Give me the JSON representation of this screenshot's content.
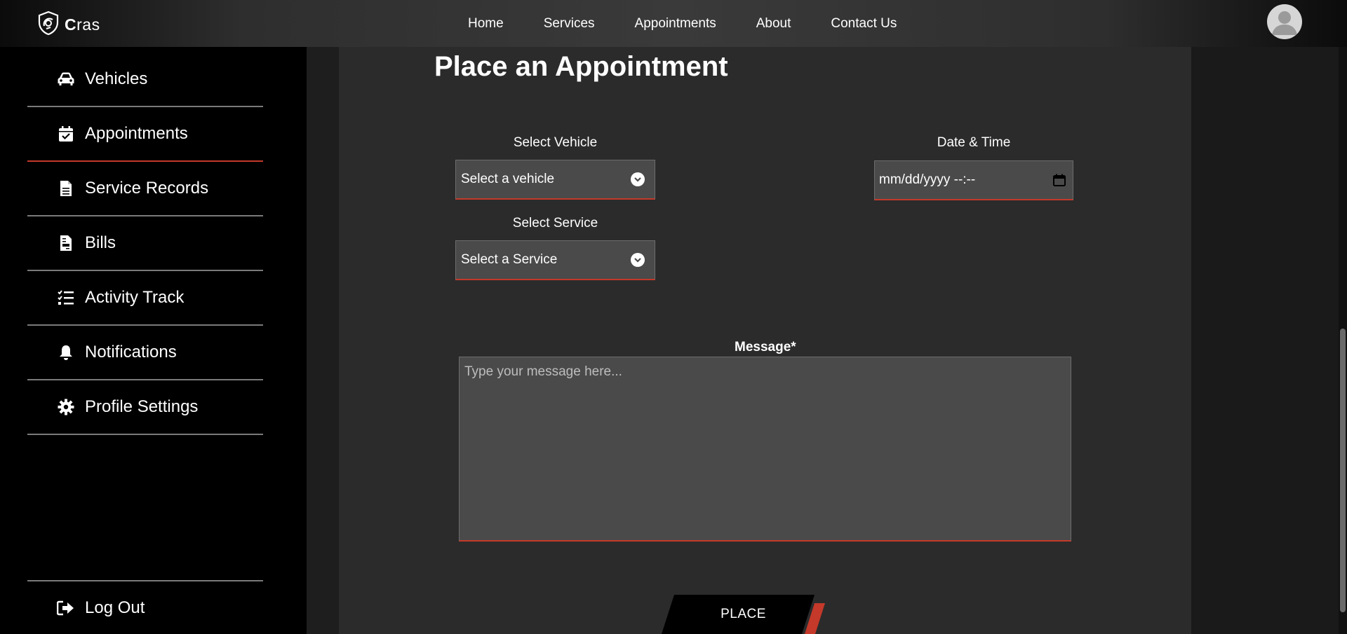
{
  "brand": {
    "name": "Cras"
  },
  "nav": {
    "links": [
      "Home",
      "Services",
      "Appointments",
      "About",
      "Contact Us"
    ]
  },
  "sidebar": {
    "items": [
      {
        "label": "Vehicles",
        "icon": "car-icon"
      },
      {
        "label": "Appointments",
        "icon": "calendar-check-icon",
        "active": true
      },
      {
        "label": "Service Records",
        "icon": "document-icon"
      },
      {
        "label": "Bills",
        "icon": "invoice-icon"
      },
      {
        "label": "Activity Track",
        "icon": "tasks-list-icon"
      },
      {
        "label": "Notifications",
        "icon": "bell-icon"
      },
      {
        "label": "Profile Settings",
        "icon": "gear-icon"
      }
    ],
    "logout": {
      "label": "Log Out",
      "icon": "logout-icon"
    }
  },
  "main": {
    "title": "Place an Appointment",
    "vehicle": {
      "label": "Select Vehicle",
      "value": "Select a vehicle"
    },
    "service": {
      "label": "Select Service",
      "value": "Select a Service"
    },
    "datetime": {
      "label": "Date & Time",
      "value": "mm/dd/yyyy --:--"
    },
    "message": {
      "label": "Message*",
      "placeholder": "Type your message here..."
    },
    "submit_label": "PLACE"
  },
  "colors": {
    "accent": "#c4392a",
    "panel": "#2b2b2b",
    "field": "#4a4a4a",
    "sidebar": "#000000"
  }
}
